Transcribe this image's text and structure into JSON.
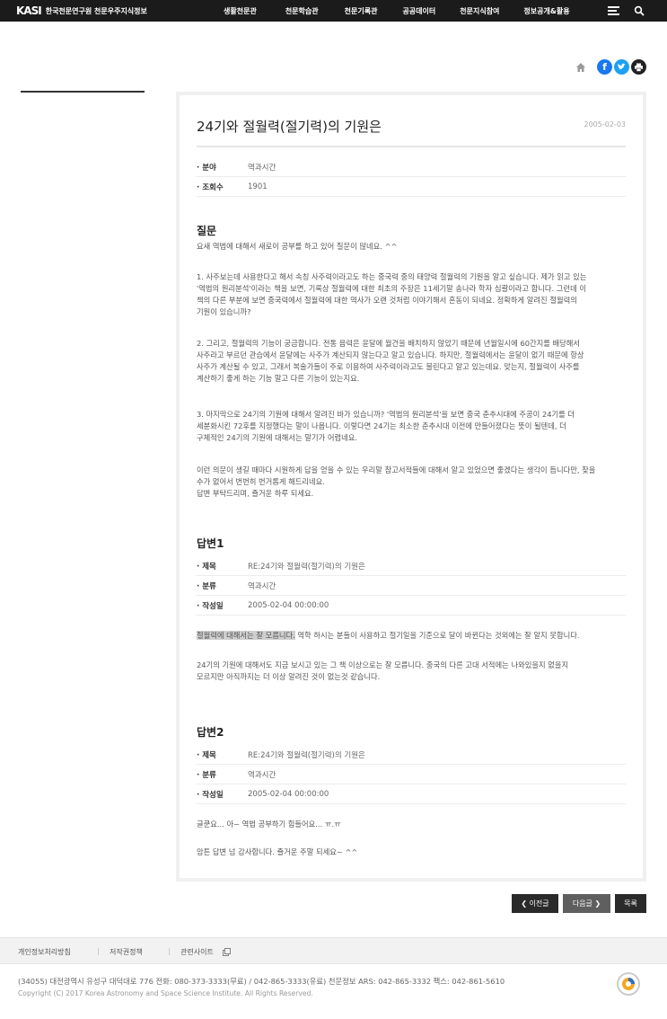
{
  "header": {
    "logo_mark": "KASI",
    "logo_text": "한국천문연구원 천문우주지식정보",
    "nav": [
      "생활천문관",
      "천문학습관",
      "천문기록관",
      "공공데이터",
      "천문지식참여",
      "정보공개&활용"
    ]
  },
  "icons": {
    "home": "home-icon",
    "facebook": "facebook-icon",
    "twitter": "twitter-icon",
    "print": "print-icon",
    "menu": "menu-icon",
    "search": "search-icon"
  },
  "colors": {
    "facebook": "#1877f2",
    "twitter": "#1da1f2"
  },
  "article": {
    "title": "24기와 절월력(절기력)의 기원은",
    "date": "2005-02-03",
    "meta": [
      {
        "label": "· 분야",
        "value": "역과시간"
      },
      {
        "label": "· 조회수",
        "value": "1901"
      }
    ]
  },
  "question": {
    "heading": "질문",
    "paragraphs": [
      [
        "요새 역법에 대해서 새로이 공부를 하고 있어 질문이 많네요. ^^"
      ],
      [
        "1. 사주보는데 사용한다고 해서 속칭 사주력이라고도 하는 중국력 중의 태양력 절월력의 기원을 알고 싶습니다. 제가 읽고 있는",
        "'역법의 원리분석'이라는 책을 보면, 기록상 절월력에 대한 최초의 주장은 11세기말 송나라 학자 심괄이라고 합니다. 그런데 이",
        "책의 다른 부분에 보면 중국력에서 절월력에 대한 역사가 오랜 것처럼 이야기해서 혼동이 되네요. 정확하게 알려진 절월력의",
        "기원이 있습니까?"
      ],
      [
        "2. 그리고, 절월력의 기능이 궁금합니다. 전통 음력은 윤달에 월건을 배치하지 않았기 때문에 년월일시에 60간지를 배당해서",
        "사주라고 부르던 관습에서 윤달에는 사주가 계산되지 않는다고 알고 있습니다. 하지만, 절월력에서는 윤달이 없기 때문에 항상",
        "사주가 계산될 수 있고, 그래서 복술가들이 주로 이용하여 사주력이라고도 불린다고 알고 있는데요. 맞는지, 절월력이 사주를",
        "계산하기 좋게 하는 기능 말고 다른 기능이 있는지요."
      ],
      [
        "3. 마지막으로 24기의 기원에 대해서 알려진 바가 있습니까? '역법의 원리분석'을 보면 중국 춘추시대에 주공이 24기를 더",
        "세분화시킨 72후를 지정했다는 말이 나옵니다. 이렇다면 24기는 최소한 춘추시대 이전에 만들어졌다는 뜻이 될텐데, 더",
        "구체적인 24기의 기원에 대해서는 말기가 어렵네요."
      ],
      [
        "이런 의문이 생길 때마다 시원하게 답을 얻을 수 있는 우리말 참고서적들에 대해서 알고 있었으면 좋겠다는 생각이 듭니다만, 찾을",
        "수가 없어서 번번히 번거롭게 해드리네요.",
        "답변 부탁드리며, 즐거운 하루 되세요."
      ]
    ]
  },
  "answers": [
    {
      "heading": "답변1",
      "meta": [
        {
          "label": "· 제목",
          "value": "RE:24기와 절월력(절기력)의 기원은"
        },
        {
          "label": "· 분류",
          "value": "역과시간"
        },
        {
          "label": "· 작성일",
          "value": "2005-02-04 00:00:00"
        }
      ],
      "highlight": "절월력에 대해서는 잘 모릅니다.",
      "first_line_rest": " 역학 하시는 분들이 사용하고 절기일을 기준으로 달이 바뀐다는 것외에는 잘 알지 못합니다.",
      "paragraphs": [
        [
          "24기의 기원에 대해서도 지금 보시고 있는 그 책 이상으로는 잘 모릅니다. 중국의 다른 고대 서적에는 나와있을지 없을지",
          "모르지만 아직까지는 더 이상 알려진 것이 없는것 같습니다."
        ]
      ]
    },
    {
      "heading": "답변2",
      "meta": [
        {
          "label": "· 제목",
          "value": "RE:24기와 절월력(절기력)의 기원은"
        },
        {
          "label": "· 분류",
          "value": "역과시간"
        },
        {
          "label": "· 작성일",
          "value": "2005-02-04 00:00:00"
        }
      ],
      "paragraphs": [
        [
          "글쿤요... 아~ 역법 공부하기 힘들어요... ㅠ.ㅠ"
        ],
        [
          "암튼 답변 넘 감사합니다. 즐거운 주말 되세요~ ^^"
        ]
      ]
    }
  ],
  "pager": {
    "prev": "❮ 이전글",
    "next": "다음글 ❯",
    "list": "목록"
  },
  "footer": {
    "links": [
      "개인정보처리방침",
      "저작권정책",
      "관련사이트"
    ],
    "address": "(34055) 대전광역시 유성구 대덕대로 776   전화: 080-373-3333(무료) / 042-865-3333(유료)   천문정보 ARS: 042-865-3332   팩스: 042-861-5610",
    "copyright": "Copyright (C) 2017 Korea Astronomy and Space Science Institute. All Rights Reserved."
  }
}
